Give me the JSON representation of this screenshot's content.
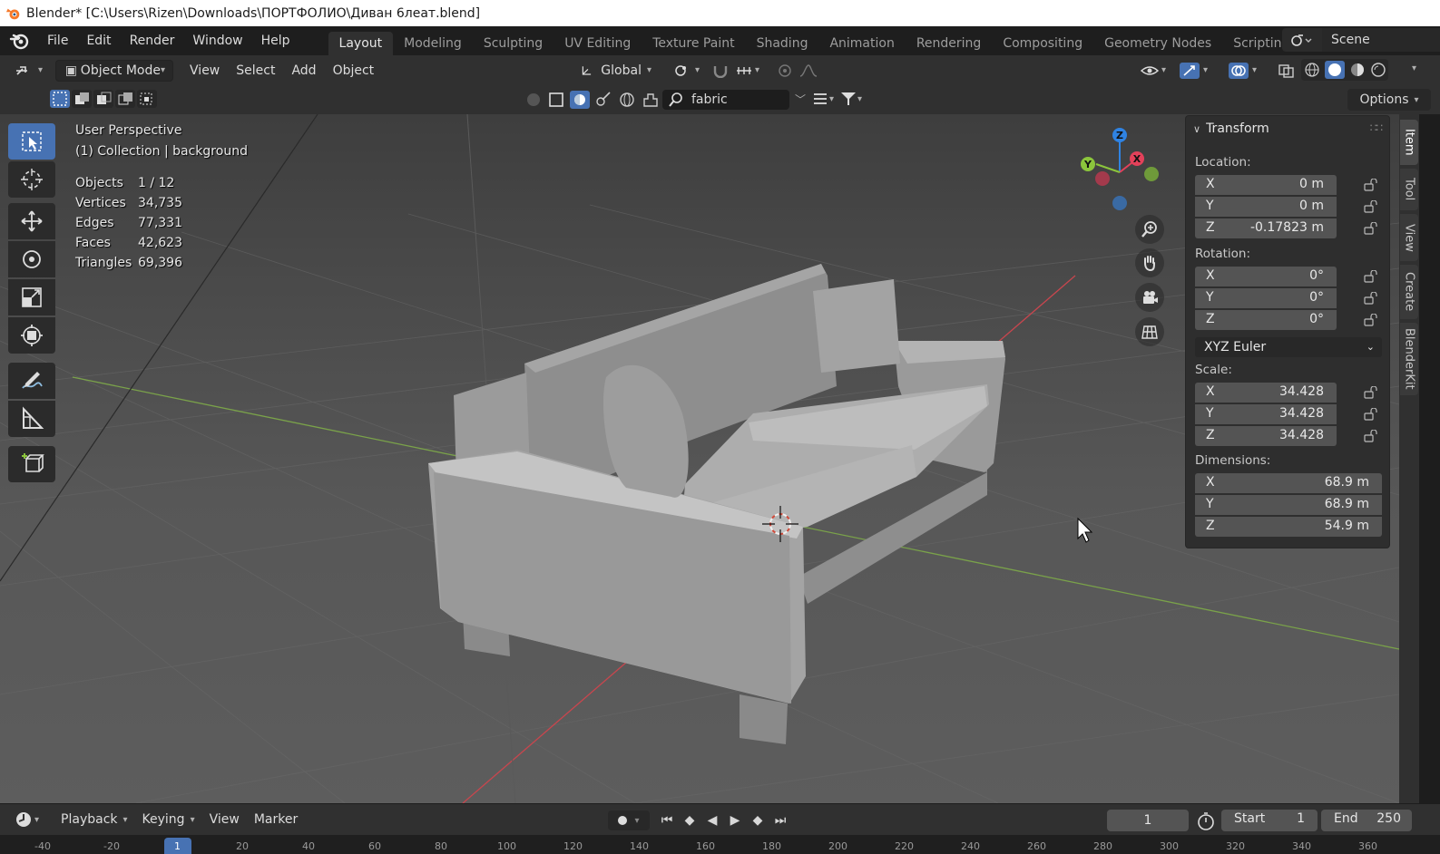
{
  "window": {
    "title": "Blender* [C:\\Users\\Rizen\\Downloads\\ПОРТФОЛИО\\Диван 6леат.blend]"
  },
  "topbar": {
    "menus": [
      "File",
      "Edit",
      "Render",
      "Window",
      "Help"
    ],
    "workspaces": [
      "Layout",
      "Modeling",
      "Sculpting",
      "UV Editing",
      "Texture Paint",
      "Shading",
      "Animation",
      "Rendering",
      "Compositing",
      "Geometry Nodes",
      "Scripting"
    ],
    "active_workspace": "Layout",
    "add_workspace": "+",
    "scene": "Scene"
  },
  "header": {
    "mode": "Object Mode",
    "menus": [
      "View",
      "Select",
      "Add",
      "Object"
    ],
    "orientation": "Global",
    "search_value": "fabric",
    "options": "Options"
  },
  "viewport": {
    "perspective": "User Perspective",
    "collection": "(1) Collection | background",
    "stats": [
      {
        "label": "Objects",
        "value": "1 / 12"
      },
      {
        "label": "Vertices",
        "value": "34,735"
      },
      {
        "label": "Edges",
        "value": "77,331"
      },
      {
        "label": "Faces",
        "value": "42,623"
      },
      {
        "label": "Triangles",
        "value": "69,396"
      }
    ],
    "gizmo": {
      "x": "X",
      "y": "Y",
      "z": "Z"
    }
  },
  "npanel": {
    "title": "Transform",
    "location_label": "Location:",
    "location": [
      {
        "axis": "X",
        "value": "0 m"
      },
      {
        "axis": "Y",
        "value": "0 m"
      },
      {
        "axis": "Z",
        "value": "-0.17823 m"
      }
    ],
    "rotation_label": "Rotation:",
    "rotation": [
      {
        "axis": "X",
        "value": "0°"
      },
      {
        "axis": "Y",
        "value": "0°"
      },
      {
        "axis": "Z",
        "value": "0°"
      }
    ],
    "rotation_mode": "XYZ Euler",
    "scale_label": "Scale:",
    "scale": [
      {
        "axis": "X",
        "value": "34.428"
      },
      {
        "axis": "Y",
        "value": "34.428"
      },
      {
        "axis": "Z",
        "value": "34.428"
      }
    ],
    "dimensions_label": "Dimensions:",
    "dimensions": [
      {
        "axis": "X",
        "value": "68.9 m"
      },
      {
        "axis": "Y",
        "value": "68.9 m"
      },
      {
        "axis": "Z",
        "value": "54.9 m"
      }
    ]
  },
  "sidetabs": [
    "Item",
    "Tool",
    "View",
    "Create",
    "BlenderKit"
  ],
  "timeline": {
    "menus": [
      "Playback",
      "Keying",
      "View",
      "Marker"
    ],
    "current_frame": "1",
    "start_label": "Start",
    "start": "1",
    "end_label": "End",
    "end": "250",
    "ruler": [
      "-40",
      "-20",
      "1",
      "20",
      "40",
      "60",
      "80",
      "100",
      "120",
      "140",
      "160",
      "180",
      "200",
      "220",
      "240",
      "260",
      "280",
      "300",
      "320",
      "340",
      "360"
    ]
  },
  "colors": {
    "accent": "#4772b3",
    "axis_x": "#e3415a",
    "axis_y": "#8bc53c",
    "axis_z": "#2f83e3"
  }
}
